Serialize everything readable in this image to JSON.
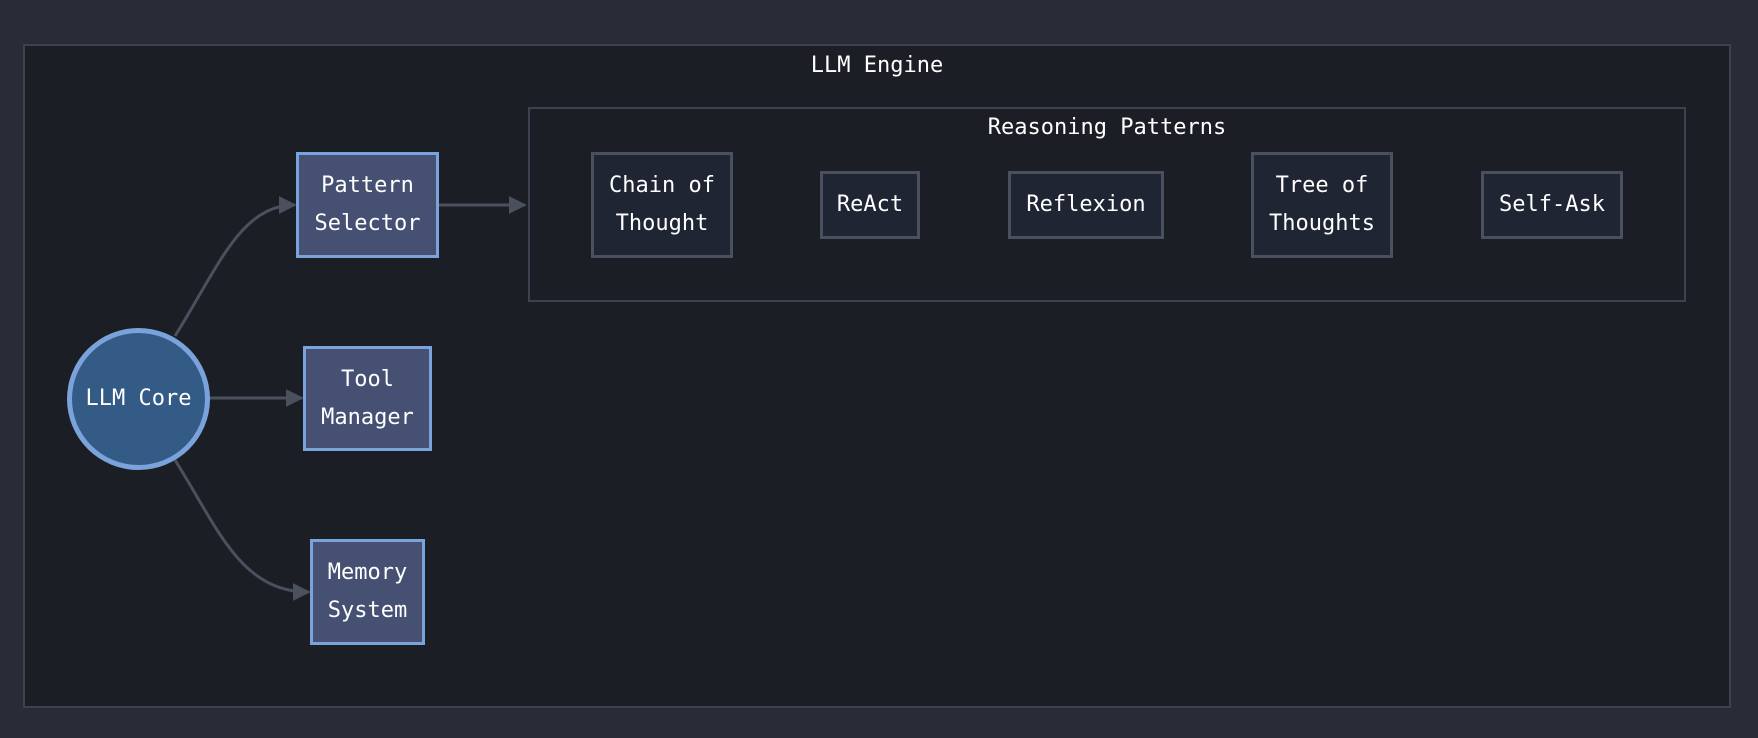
{
  "engine": {
    "title": "LLM Engine",
    "core": {
      "label": "LLM Core"
    },
    "modules": [
      {
        "label": "Pattern\nSelector"
      },
      {
        "label": "Tool\nManager"
      },
      {
        "label": "Memory\nSystem"
      }
    ]
  },
  "reasoning": {
    "title": "Reasoning Patterns",
    "patterns": [
      {
        "label": "Chain of\nThought"
      },
      {
        "label": "ReAct"
      },
      {
        "label": "Reflexion"
      },
      {
        "label": "Tree of\nThoughts"
      },
      {
        "label": "Self-Ask"
      }
    ]
  },
  "colors": {
    "background": "#282c37",
    "cluster_fill": "#1b1e24",
    "core_fill": "#345a86",
    "node_border": "#7ba3db",
    "module_fill": "#465073",
    "pattern_fill": "#202534",
    "edge": "#4b505e"
  }
}
